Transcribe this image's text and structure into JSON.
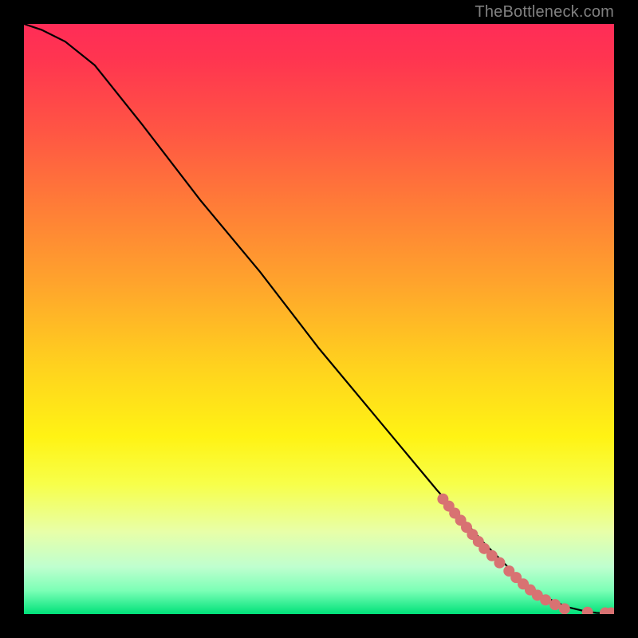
{
  "watermark": "TheBottleneck.com",
  "chart_data": {
    "type": "line",
    "title": "",
    "xlabel": "",
    "ylabel": "",
    "xlim": [
      0,
      100
    ],
    "ylim": [
      0,
      100
    ],
    "curve": {
      "name": "bottleneck-curve",
      "x": [
        0,
        3,
        7,
        12,
        20,
        30,
        40,
        50,
        60,
        70,
        78,
        84,
        88,
        92,
        95,
        97,
        99,
        100
      ],
      "y": [
        100,
        99,
        97,
        93,
        83,
        70,
        58,
        45,
        33,
        21,
        12,
        6,
        3,
        1.2,
        0.5,
        0.2,
        0.1,
        0.1
      ]
    },
    "highlighted_points": {
      "name": "marked-points",
      "color": "#d87272",
      "radius": 7,
      "points": [
        {
          "x": 71,
          "y": 19.5
        },
        {
          "x": 72,
          "y": 18.3
        },
        {
          "x": 73,
          "y": 17.1
        },
        {
          "x": 74,
          "y": 15.9
        },
        {
          "x": 75,
          "y": 14.7
        },
        {
          "x": 76,
          "y": 13.5
        },
        {
          "x": 77,
          "y": 12.3
        },
        {
          "x": 78,
          "y": 11.1
        },
        {
          "x": 79.3,
          "y": 9.9
        },
        {
          "x": 80.6,
          "y": 8.7
        },
        {
          "x": 82.2,
          "y": 7.3
        },
        {
          "x": 83.4,
          "y": 6.2
        },
        {
          "x": 84.6,
          "y": 5.1
        },
        {
          "x": 85.8,
          "y": 4.1
        },
        {
          "x": 87.0,
          "y": 3.2
        },
        {
          "x": 88.4,
          "y": 2.4
        },
        {
          "x": 90.0,
          "y": 1.6
        },
        {
          "x": 91.6,
          "y": 0.9
        },
        {
          "x": 95.5,
          "y": 0.3
        },
        {
          "x": 98.5,
          "y": 0.2
        },
        {
          "x": 99.5,
          "y": 0.2
        }
      ]
    }
  }
}
